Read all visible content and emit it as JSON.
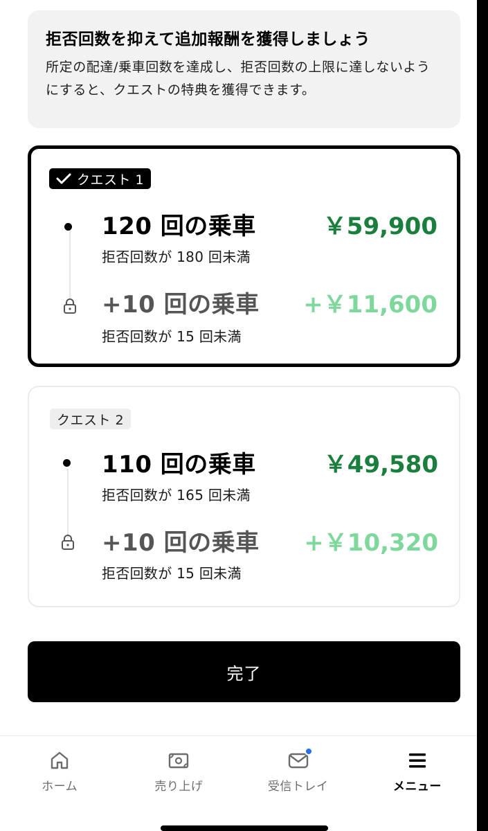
{
  "info": {
    "title": "拒否回数を抑えて追加報酬を獲得しましょう",
    "description": "所定の配達/乗車回数を達成し、拒否回数の上限に達しないようにすると、クエストの特典を獲得できます。"
  },
  "quests": [
    {
      "badge": "クエスト 1",
      "completed": true,
      "tiers": [
        {
          "title": "120 回の乗車",
          "subtitle": "拒否回数が 180 回未満",
          "reward": "￥59,900",
          "locked": false
        },
        {
          "title": "+10 回の乗車",
          "subtitle": "拒否回数が 15 回未満",
          "reward": "+￥11,600",
          "locked": true
        }
      ]
    },
    {
      "badge": "クエスト 2",
      "completed": false,
      "tiers": [
        {
          "title": "110 回の乗車",
          "subtitle": "拒否回数が 165 回未満",
          "reward": "￥49,580",
          "locked": false
        },
        {
          "title": "+10 回の乗車",
          "subtitle": "拒否回数が 15 回未満",
          "reward": "+￥10,320",
          "locked": true
        }
      ]
    }
  ],
  "done_button": "完了",
  "nav": [
    {
      "label": "ホーム",
      "icon": "home-icon",
      "current": false
    },
    {
      "label": "売り上げ",
      "icon": "earnings-icon",
      "current": false
    },
    {
      "label": "受信トレイ",
      "icon": "inbox-icon",
      "current": false,
      "has_notification": true
    },
    {
      "label": "メニュー",
      "icon": "menu-icon",
      "current": true
    }
  ],
  "colors": {
    "reward_main": "#1a7f3c",
    "reward_bonus": "#7ed79b",
    "notification": "#276ef1",
    "button": "#000000"
  }
}
